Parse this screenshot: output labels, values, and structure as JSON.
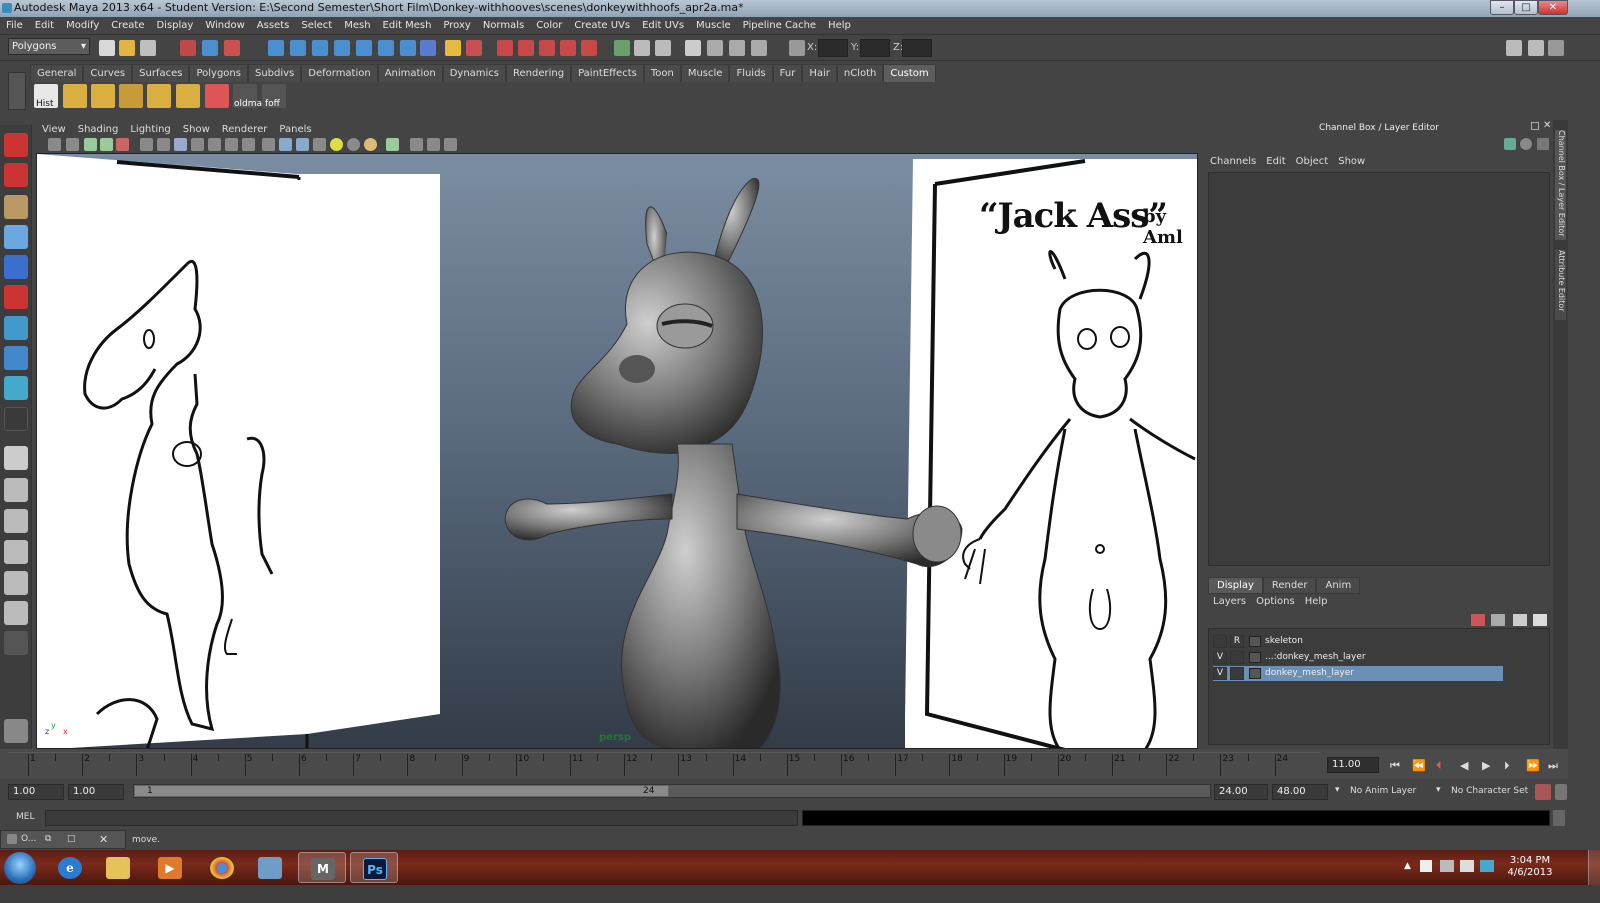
{
  "window": {
    "title": "Autodesk Maya 2013 x64 - Student Version: E:\\Second Semester\\Short Film\\Donkey-withhooves\\scenes\\donkeywithhoofs_apr2a.ma*"
  },
  "menubar": [
    "File",
    "Edit",
    "Modify",
    "Create",
    "Display",
    "Window",
    "Assets",
    "Select",
    "Mesh",
    "Edit Mesh",
    "Proxy",
    "Normals",
    "Color",
    "Create UVs",
    "Edit UVs",
    "Muscle",
    "Pipeline Cache",
    "Help"
  ],
  "status_line": {
    "mode": "Polygons",
    "x_label": "X:",
    "y_label": "Y:",
    "z_label": "Z:"
  },
  "shelf": {
    "tabs": [
      "General",
      "Curves",
      "Surfaces",
      "Polygons",
      "Subdivs",
      "Deformation",
      "Animation",
      "Dynamics",
      "Rendering",
      "PaintEffects",
      "Toon",
      "Muscle",
      "Fluids",
      "Fur",
      "Hair",
      "nCloth",
      "Custom"
    ],
    "active_tab": "Custom",
    "buttons": [
      "Hist",
      "",
      "",
      "",
      "",
      "",
      "",
      "oldma",
      "foff"
    ]
  },
  "panel_menu": [
    "View",
    "Shading",
    "Lighting",
    "Show",
    "Renderer",
    "Panels"
  ],
  "viewport": {
    "camera": "persp",
    "sheet_title": "“Jack Ass”",
    "sheet_byline": "by Aml"
  },
  "channel_box": {
    "title": "Channel Box / Layer Editor",
    "menu": [
      "Channels",
      "Edit",
      "Object",
      "Show"
    ],
    "layer_tabs": [
      "Display",
      "Render",
      "Anim"
    ],
    "active_layer_tab": "Display",
    "layer_menu": [
      "Layers",
      "Options",
      "Help"
    ],
    "layers": [
      {
        "v": "",
        "r": "R",
        "name": "skeleton"
      },
      {
        "v": "V",
        "r": "",
        "name": "...:donkey_mesh_layer"
      },
      {
        "v": "V",
        "r": "",
        "name": "donkey_mesh_layer",
        "selected": true
      }
    ]
  },
  "side_tabs": [
    "Channel Box / Layer Editor",
    "Attribute Editor"
  ],
  "timeline": {
    "ticks": [
      "1",
      "2",
      "3",
      "4",
      "5",
      "6",
      "7",
      "8",
      "9",
      "10",
      "11",
      "12",
      "13",
      "14",
      "15",
      "16",
      "17",
      "18",
      "19",
      "20",
      "21",
      "22",
      "23",
      "24"
    ],
    "current_frame": "11.00"
  },
  "range": {
    "start": "1.00",
    "anim_start": "1.00",
    "handle_start": "1",
    "handle_end": "24",
    "end": "24.00",
    "anim_end": "48.00",
    "anim_layer": "No Anim Layer",
    "character_set": "No Character Set"
  },
  "command": {
    "lang": "MEL"
  },
  "help_line": {
    "text": "move."
  },
  "minibar": {
    "label": "O..."
  },
  "taskbar": {
    "time": "3:04 PM",
    "date": "4/6/2013",
    "ps_label": "Ps"
  },
  "colors": {
    "accent": "#6b8fb5",
    "viewport_top": "#7b8da2",
    "viewport_bottom": "#333c48",
    "taskbar": "#6a2416"
  }
}
